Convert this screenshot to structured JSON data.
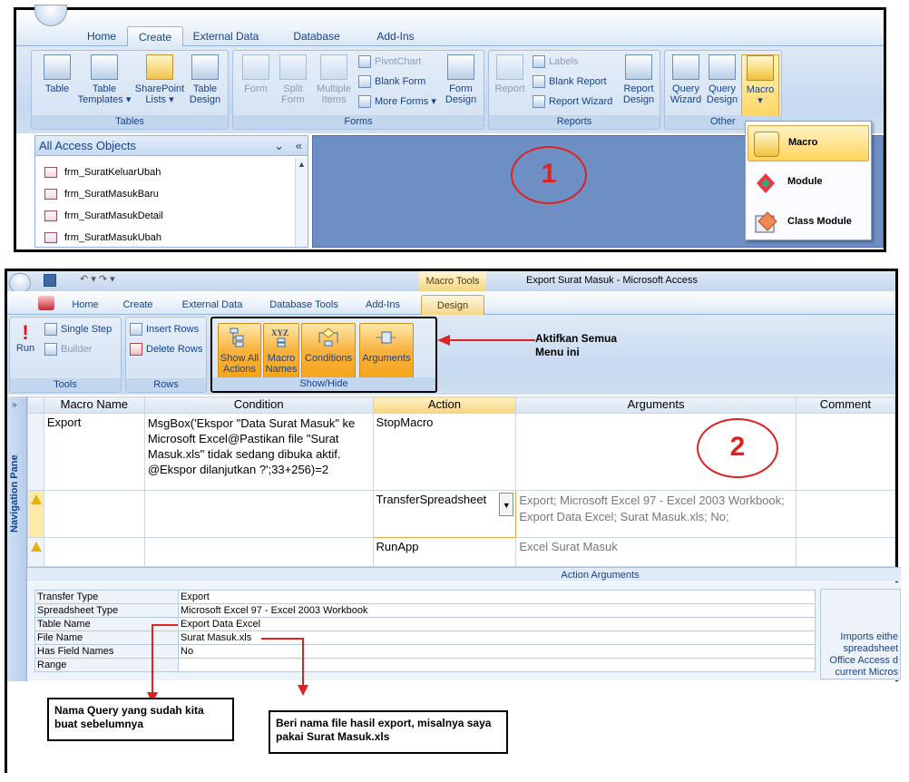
{
  "panel1": {
    "tabs": [
      "Home",
      "Create",
      "External Data",
      "Database Tools",
      "Add-Ins"
    ],
    "active_tab": "Create",
    "groups": {
      "tables": {
        "label": "Tables",
        "buttons": [
          "Table",
          "Table Templates ▾",
          "SharePoint Lists ▾",
          "Table Design"
        ]
      },
      "forms": {
        "label": "Forms",
        "buttons": [
          "Form",
          "Split Form",
          "Multiple Items"
        ],
        "small": [
          "PivotChart",
          "Blank Form",
          "More Forms ▾"
        ],
        "design": "Form Design"
      },
      "reports": {
        "label": "Reports",
        "buttons": [
          "Report"
        ],
        "small": [
          "Labels",
          "Blank Report",
          "Report Wizard"
        ],
        "design": "Report Design"
      },
      "other": {
        "label": "Other",
        "buttons": [
          "Query Wizard",
          "Query Design",
          "Macro"
        ]
      }
    },
    "nav": {
      "title": "All Access Objects",
      "items": [
        "frm_SuratKeluarUbah",
        "frm_SuratMasukBaru",
        "frm_SuratMasukDetail",
        "frm_SuratMasukUbah"
      ]
    },
    "dropdown": [
      "Macro",
      "Module",
      "Class Module"
    ],
    "step_number": "1"
  },
  "panel2": {
    "window_title": "Export Surat Masuk - Microsoft Access",
    "context_tab": "Macro Tools",
    "tabs": [
      "Home",
      "Create",
      "External Data",
      "Database Tools",
      "Add-Ins",
      "Design"
    ],
    "active_tab": "Design",
    "tools_group": {
      "label": "Tools",
      "run": "Run",
      "single_step": "Single Step",
      "builder": "Builder"
    },
    "rows_group": {
      "label": "Rows",
      "insert": "Insert Rows",
      "delete": "Delete Rows"
    },
    "showhide_group": {
      "label": "Show/Hide",
      "buttons": [
        "Show All Actions",
        "Macro Names",
        "Conditions",
        "Arguments"
      ]
    },
    "annotation_showhide": "Aktifkan Semua Menu ini",
    "columns": [
      "Macro Name",
      "Condition",
      "Action",
      "Arguments",
      "Comment"
    ],
    "rows": [
      {
        "macro_name": "Export",
        "condition": "MsgBox('Ekspor \"Data Surat Masuk\" ke Microsoft  Excel@Pastikan file \"Surat Masuk.xls\" tidak sedang dibuka aktif. @Ekspor dilanjutkan ?';33+256)=2",
        "action": "StopMacro",
        "arguments": "",
        "comment": ""
      },
      {
        "macro_name": "",
        "condition": "",
        "action": "TransferSpreadsheet",
        "arguments": "Export; Microsoft Excel 97 - Excel 2003 Workbook; Export Data Excel; Surat Masuk.xls; No;",
        "comment": ""
      },
      {
        "macro_name": "",
        "condition": "",
        "action": "RunApp",
        "arguments": "Excel Surat Masuk",
        "comment": ""
      }
    ],
    "action_arguments_label": "Action Arguments",
    "action_arguments": [
      {
        "key": "Transfer Type",
        "value": "Export"
      },
      {
        "key": "Spreadsheet Type",
        "value": "Microsoft Excel 97 - Excel 2003 Workbook"
      },
      {
        "key": "Table Name",
        "value": "Export Data Excel"
      },
      {
        "key": "File Name",
        "value": "Surat Masuk.xls"
      },
      {
        "key": "Has Field Names",
        "value": "No"
      },
      {
        "key": "Range",
        "value": ""
      }
    ],
    "help_text": "Imports eithe spreadsheet Office Access d current Micros",
    "nav_pane_label": "Navigation Pane",
    "step_number": "2",
    "callout_query": "Nama Query yang sudah kita buat sebelumnya",
    "callout_file": "Beri nama file hasil export, misalnya saya pakai Surat Masuk.xls"
  },
  "colors": {
    "annotation_red": "#dd2222",
    "ribbon_blue": "#c6d9f1",
    "highlight_orange": "#f8b23d",
    "workarea": "#6e8fc4"
  }
}
